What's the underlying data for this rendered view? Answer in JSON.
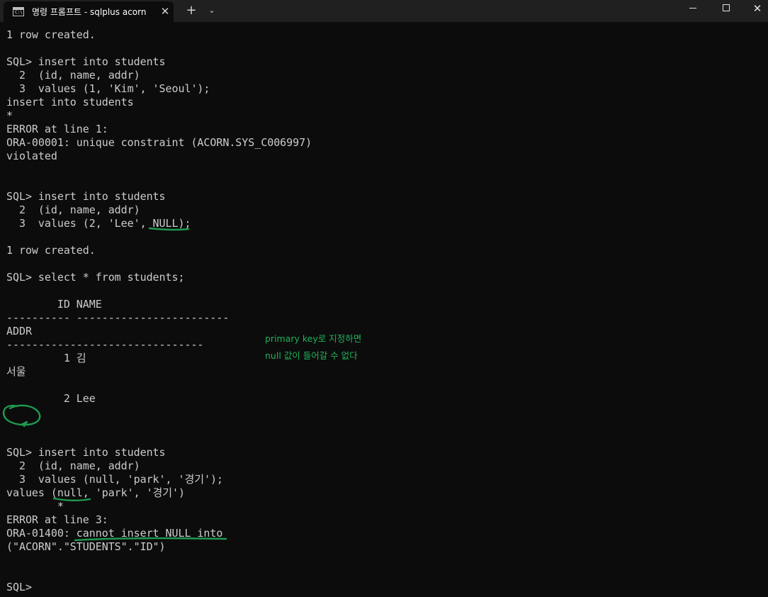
{
  "window": {
    "tab_title": "명령 프롬프트 - sqlplus  acorn",
    "tab_icon_text": "C:\\",
    "close_tab_glyph": "✕",
    "new_tab_glyph": "+",
    "dropdown_glyph": "⌄",
    "close_window_glyph": "✕"
  },
  "console": {
    "lines": [
      "1 row created.",
      "",
      "SQL> insert into students",
      "  2  (id, name, addr)",
      "  3  values (1, 'Kim', 'Seoul');",
      "insert into students",
      "*",
      "ERROR at line 1:",
      "ORA-00001: unique constraint (ACORN.SYS_C006997)",
      "violated",
      "",
      "",
      "SQL> insert into students",
      "  2  (id, name, addr)",
      "  3  values (2, 'Lee', NULL);",
      "",
      "1 row created.",
      "",
      "SQL> select * from students;",
      "",
      "        ID NAME",
      "---------- ------------------------",
      "ADDR",
      "-------------------------------",
      "         1 김",
      "서울",
      "",
      "         2 Lee",
      "",
      "",
      "",
      "SQL> insert into students",
      "  2  (id, name, addr)",
      "  3  values (null, 'park', '경기');",
      "values (null, 'park', '경기')",
      "        *",
      "ERROR at line 3:",
      "ORA-01400: cannot insert NULL into",
      "(\"ACORN\".\"STUDENTS\".\"ID\")",
      "",
      "",
      "SQL>"
    ]
  },
  "annotation": {
    "line1": "primary key로 지정하면",
    "line2": "null 값이 들어갈 수 없다",
    "color": "#1fa855"
  }
}
